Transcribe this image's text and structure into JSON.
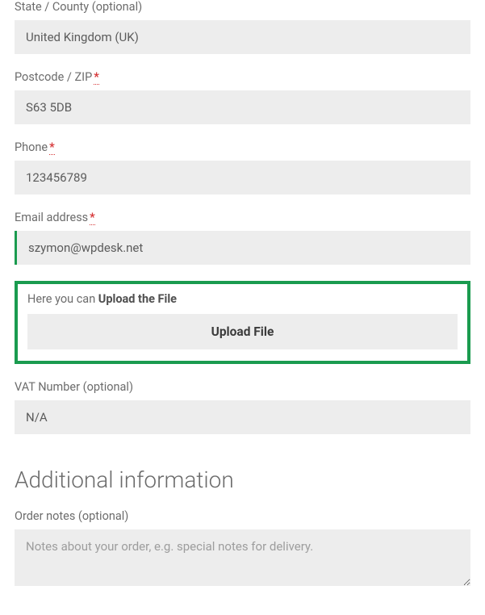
{
  "form": {
    "state": {
      "label": "State / County (optional)",
      "value": "United Kingdom (UK)"
    },
    "postcode": {
      "label": "Postcode / ZIP",
      "required": "*",
      "value": "S63 5DB"
    },
    "phone": {
      "label": "Phone",
      "required": "*",
      "value": "123456789"
    },
    "email": {
      "label": "Email address",
      "required": "*",
      "value": "szymon@wpdesk.net"
    },
    "upload": {
      "hint_prefix": "Here you can ",
      "hint_bold": "Upload the File",
      "button": "Upload File"
    },
    "vat": {
      "label": "VAT Number (optional)",
      "value": "N/A"
    }
  },
  "additional": {
    "heading": "Additional information",
    "notes": {
      "label": "Order notes (optional)",
      "placeholder": "Notes about your order, e.g. special notes for delivery."
    }
  }
}
